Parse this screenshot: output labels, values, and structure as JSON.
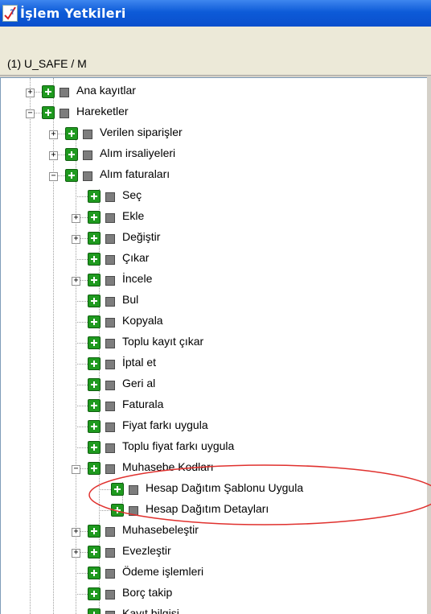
{
  "window": {
    "title": "İşlem Yetkileri"
  },
  "user": {
    "label": "(1) U_SAFE / M"
  },
  "tree": {
    "items": [
      {
        "label": "Ana kayıtlar",
        "level": 0,
        "expander": "+"
      },
      {
        "label": "Hareketler",
        "level": 0,
        "expander": "−"
      },
      {
        "label": "Verilen siparişler",
        "level": 1,
        "expander": "+"
      },
      {
        "label": "Alım irsaliyeleri",
        "level": 1,
        "expander": "+"
      },
      {
        "label": "Alım faturaları",
        "level": 1,
        "expander": "−"
      },
      {
        "label": "Seç",
        "level": 2,
        "expander": ""
      },
      {
        "label": "Ekle",
        "level": 2,
        "expander": "+"
      },
      {
        "label": "Değiştir",
        "level": 2,
        "expander": "+"
      },
      {
        "label": "Çıkar",
        "level": 2,
        "expander": ""
      },
      {
        "label": "İncele",
        "level": 2,
        "expander": "+"
      },
      {
        "label": "Bul",
        "level": 2,
        "expander": ""
      },
      {
        "label": "Kopyala",
        "level": 2,
        "expander": ""
      },
      {
        "label": "Toplu kayıt çıkar",
        "level": 2,
        "expander": ""
      },
      {
        "label": "İptal et",
        "level": 2,
        "expander": ""
      },
      {
        "label": "Geri al",
        "level": 2,
        "expander": ""
      },
      {
        "label": "Faturala",
        "level": 2,
        "expander": ""
      },
      {
        "label": "Fiyat farkı uygula",
        "level": 2,
        "expander": ""
      },
      {
        "label": "Toplu fiyat farkı uygula",
        "level": 2,
        "expander": ""
      },
      {
        "label": "Muhasebe Kodları",
        "level": 2,
        "expander": "−"
      },
      {
        "label": "Hesap Dağıtım Şablonu Uygula",
        "level": 3,
        "expander": ""
      },
      {
        "label": "Hesap Dağıtım Detayları",
        "level": 3,
        "expander": ""
      },
      {
        "label": "Muhasebeleştir",
        "level": 2,
        "expander": "+"
      },
      {
        "label": "Evezleştir",
        "level": 2,
        "expander": "+"
      },
      {
        "label": "Ödeme işlemleri",
        "level": 2,
        "expander": ""
      },
      {
        "label": "Borç takip",
        "level": 2,
        "expander": ""
      },
      {
        "label": "Kayıt bilgisi",
        "level": 2,
        "expander": ""
      }
    ]
  },
  "colors": {
    "titlebar": "#0a4fcc",
    "plus_icon": "#1f9a1f",
    "square_icon": "#7d7d7d",
    "annotation_ellipse": "#e0312e"
  },
  "icons": [
    "app-icon",
    "plus-icon",
    "square-icon",
    "expand-icon",
    "collapse-icon"
  ]
}
